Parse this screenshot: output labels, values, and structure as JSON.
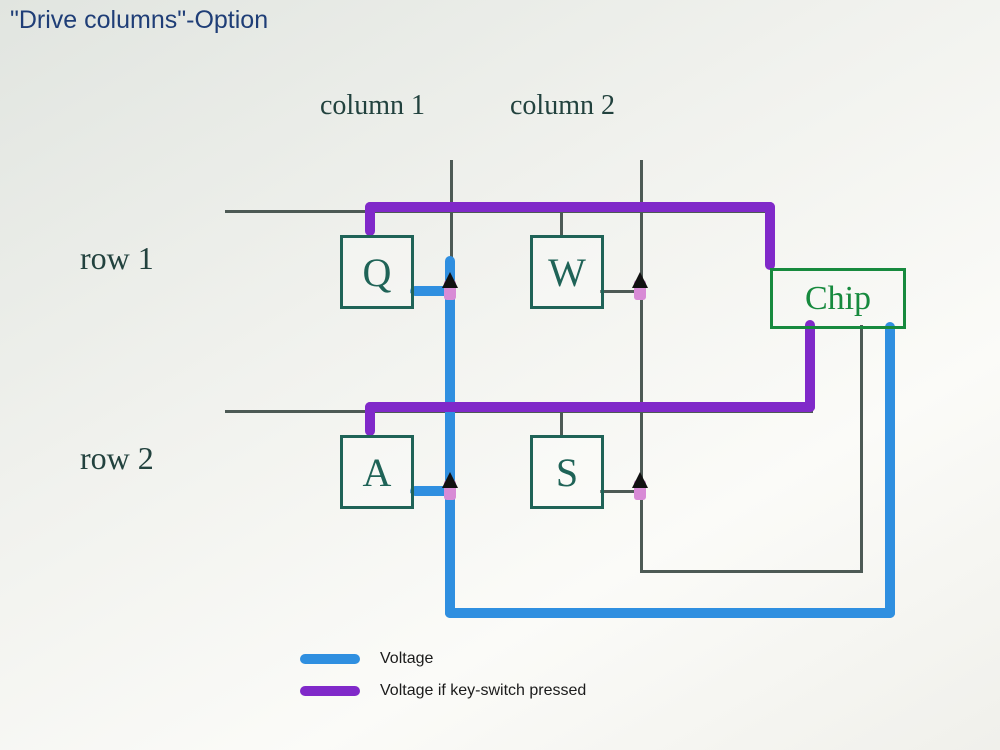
{
  "title": "\"Drive columns\"-Option",
  "columns": {
    "c1": "column 1",
    "c2": "column 2"
  },
  "rows": {
    "r1": "row 1",
    "r2": "row 2"
  },
  "keys": {
    "q": "Q",
    "w": "W",
    "a": "A",
    "s": "S"
  },
  "chip": "Chip",
  "legend": {
    "voltage": "Voltage",
    "voltage_pressed": "Voltage if key-switch pressed"
  },
  "colors": {
    "voltage": "#2f8fe0",
    "voltage_pressed": "#8029c9",
    "wire": "#4d5a55",
    "key_outline": "#1f6357",
    "chip_outline": "#178a3e",
    "title": "#1f3e77"
  }
}
